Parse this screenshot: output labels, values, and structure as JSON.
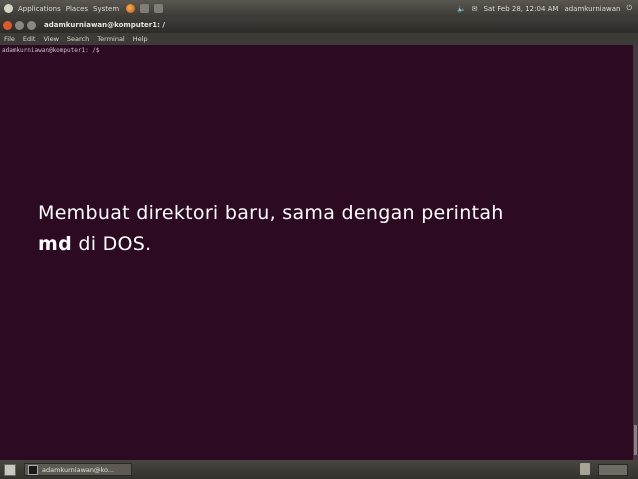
{
  "panel": {
    "menus": [
      "Applications",
      "Places",
      "System"
    ],
    "datetime": "Sat Feb 28, 12:04 AM",
    "user": "adamkurniawan"
  },
  "window": {
    "title": "adamkurniawan@komputer1: /",
    "menus": [
      "File",
      "Edit",
      "View",
      "Search",
      "Terminal",
      "Help"
    ]
  },
  "terminal": {
    "prompt_line": "adamkurniawan@komputer1: /$"
  },
  "caption": {
    "text_line1": "Membuat direktori baru, sama dengan perintah",
    "bold_word": "md",
    "text_line2_rest": " di DOS."
  },
  "taskbar": {
    "task_label": "adamkurniawan@ko..."
  }
}
